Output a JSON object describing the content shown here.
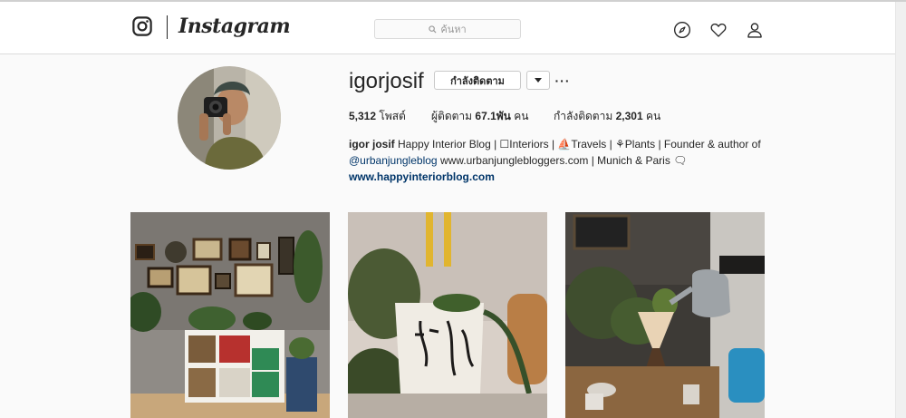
{
  "app": {
    "brand": "Instagram"
  },
  "header": {
    "search_placeholder": "ค้นหา",
    "icons": [
      "instagram-logo-icon",
      "search-icon",
      "compass-icon",
      "heart-icon",
      "user-icon"
    ]
  },
  "profile": {
    "username": "igorjosif",
    "follow_label": "กำลังติดตาม",
    "more_label": "···",
    "stats": {
      "posts_count": "5,312",
      "posts_label": "โพสต์",
      "followers_label": "ผู้ติดตาม",
      "followers_count": "67.1พัน",
      "followers_unit": "คน",
      "following_label": "กำลังติดตาม",
      "following_count": "2,301",
      "following_unit": "คน"
    },
    "bio": {
      "name": "igor josif",
      "line1": "Happy Interior Blog | ☐Interiors | ⛵Travels | ⚘Plants | Founder & author of",
      "handle": "@urbanjungleblog",
      "line2": "www.urbanjunglebloggers.com | Munich & Paris 🗨",
      "website": "www.happyinteriorblog.com"
    }
  },
  "posts": [
    {
      "name": "post-gallery-wall-shelves"
    },
    {
      "name": "post-face-planter"
    },
    {
      "name": "post-coffee-pour-over"
    }
  ],
  "colors": {
    "text": "#262626",
    "link": "#003569",
    "border": "#dbdbdb",
    "background": "#fafafa"
  }
}
